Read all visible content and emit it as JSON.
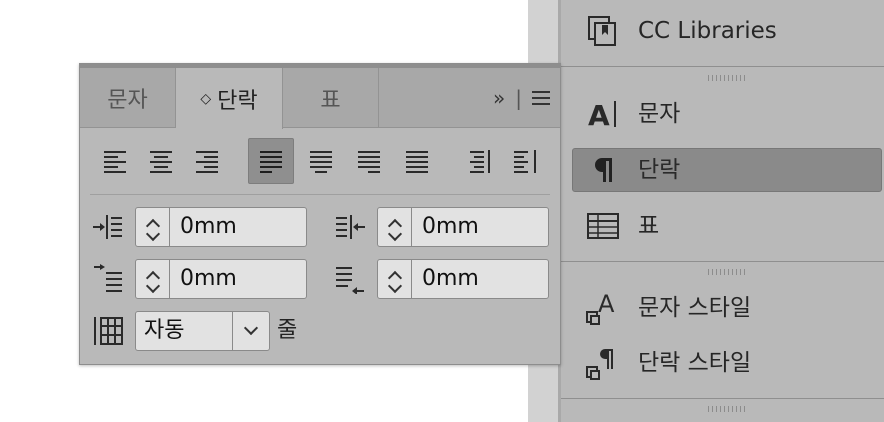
{
  "dock": {
    "items": [
      {
        "label": "CC Libraries",
        "icon": "cc-libraries-icon"
      },
      {
        "label": "문자",
        "icon": "character-icon"
      },
      {
        "label": "단락",
        "icon": "paragraph-icon",
        "selected": true
      },
      {
        "label": "표",
        "icon": "table-icon"
      },
      {
        "label": "문자 스타일",
        "icon": "character-styles-icon"
      },
      {
        "label": "단락 스타일",
        "icon": "paragraph-styles-icon"
      }
    ]
  },
  "panel": {
    "tabs": [
      {
        "label": "문자"
      },
      {
        "label": "단락",
        "active": true,
        "sort_glyph": "◇"
      },
      {
        "label": "표"
      }
    ],
    "collapse_glyph": "»",
    "separator_glyph": "|",
    "alignment_buttons": [
      {
        "icon": "align-left-icon"
      },
      {
        "icon": "align-center-icon"
      },
      {
        "icon": "align-right-icon"
      },
      {
        "icon": "justify-left-icon",
        "selected": true
      },
      {
        "icon": "justify-center-icon"
      },
      {
        "icon": "justify-right-icon"
      },
      {
        "icon": "justify-all-icon"
      },
      {
        "icon": "align-towards-spine-icon"
      },
      {
        "icon": "align-away-from-spine-icon"
      }
    ],
    "left_indent": "0mm",
    "right_indent": "0mm",
    "first_line_indent": "0mm",
    "last_line_right_indent": "0mm",
    "grid_lines": {
      "value": "자동",
      "unit": "줄"
    }
  }
}
